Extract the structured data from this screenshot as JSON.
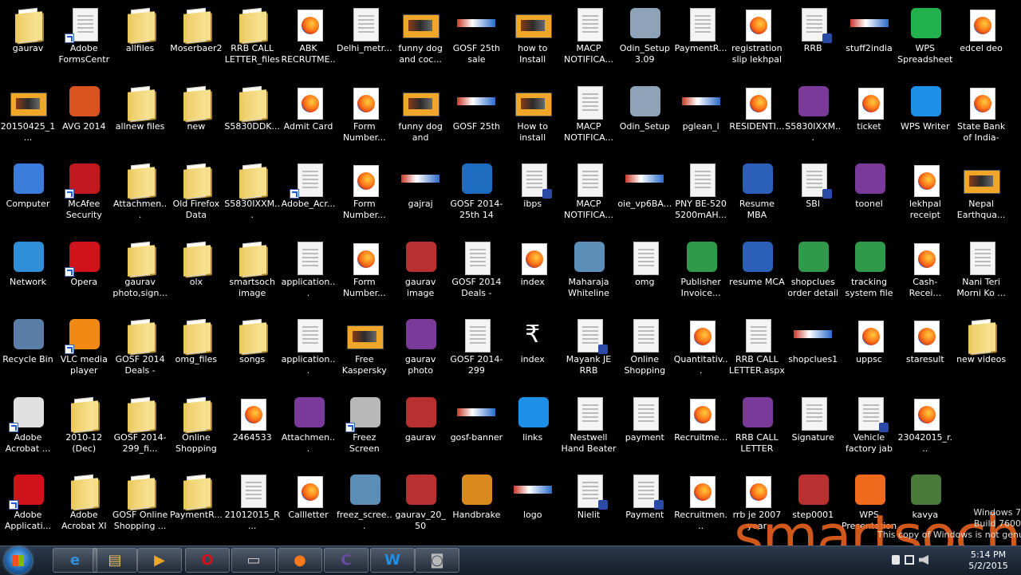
{
  "desktop": {
    "icons": [
      {
        "label": "gaurav",
        "type": "folder",
        "col": 0,
        "row": 0
      },
      {
        "label": "Adobe FormsCentral",
        "type": "doc",
        "col": 1,
        "row": 0,
        "shortcut": true
      },
      {
        "label": "allfiles",
        "type": "folder",
        "col": 2,
        "row": 0
      },
      {
        "label": "Moserbaer2",
        "type": "folder",
        "col": 3,
        "row": 0
      },
      {
        "label": "RRB CALL LETTER_files",
        "type": "folder",
        "col": 4,
        "row": 0
      },
      {
        "label": "ABK RECRUTME...",
        "type": "ff",
        "col": 5,
        "row": 0
      },
      {
        "label": "Delhi_metr...",
        "type": "doc",
        "col": 6,
        "row": 0
      },
      {
        "label": "funny dog and coc...",
        "type": "vid",
        "col": 7,
        "row": 0
      },
      {
        "label": "GOSF 25th sale",
        "type": "banner",
        "col": 8,
        "row": 0
      },
      {
        "label": "how to Install Adobe Rea...",
        "type": "vid",
        "col": 9,
        "row": 0
      },
      {
        "label": "MACP NOTIFICA...",
        "type": "doc",
        "col": 10,
        "row": 0
      },
      {
        "label": "Odin_Setup 3.09",
        "type": "app",
        "col": 11,
        "row": 0,
        "color": "#8fa3b8"
      },
      {
        "label": "PaymentR...",
        "type": "doc",
        "col": 12,
        "row": 0
      },
      {
        "label": "registration slip lekhpal",
        "type": "ff",
        "col": 13,
        "row": 0
      },
      {
        "label": "RRB",
        "type": "doc",
        "col": 14,
        "row": 0,
        "pdf": true
      },
      {
        "label": "stuff2india",
        "type": "banner",
        "col": 15,
        "row": 0
      },
      {
        "label": "WPS Spreadsheets",
        "type": "app",
        "col": 16,
        "row": 0,
        "color": "#22b14c"
      },
      {
        "label": "edcel deo",
        "type": "ff",
        "col": 17,
        "row": 0
      },
      {
        "label": "20150425_1...",
        "type": "vid",
        "col": 0,
        "row": 1
      },
      {
        "label": "AVG 2014",
        "type": "app",
        "col": 1,
        "row": 1,
        "color": "#d9531e"
      },
      {
        "label": "allnew files",
        "type": "folder",
        "col": 2,
        "row": 1
      },
      {
        "label": "new",
        "type": "folder",
        "col": 3,
        "row": 1
      },
      {
        "label": "S5830DDK...",
        "type": "folder",
        "col": 4,
        "row": 1
      },
      {
        "label": "Admit Card",
        "type": "ff",
        "col": 5,
        "row": 1
      },
      {
        "label": "Form Number...",
        "type": "ff",
        "col": 6,
        "row": 1
      },
      {
        "label": "funny dog and cockro...",
        "type": "vid",
        "col": 7,
        "row": 1
      },
      {
        "label": "GOSF 25th",
        "type": "banner",
        "col": 8,
        "row": 1
      },
      {
        "label": "How to install filezil...",
        "type": "vid",
        "col": 9,
        "row": 1
      },
      {
        "label": "MACP NOTIFICA...",
        "type": "doc",
        "col": 10,
        "row": 1
      },
      {
        "label": "Odin_Setup",
        "type": "app",
        "col": 11,
        "row": 1,
        "color": "#8fa3b8"
      },
      {
        "label": "pglean_l",
        "type": "banner",
        "col": 12,
        "row": 1
      },
      {
        "label": "RESIDENTI...",
        "type": "ff",
        "col": 13,
        "row": 1
      },
      {
        "label": "S5830IXXM...",
        "type": "app",
        "col": 14,
        "row": 1,
        "color": "#7a3a9a"
      },
      {
        "label": "ticket",
        "type": "ff",
        "col": 15,
        "row": 1
      },
      {
        "label": "WPS Writer",
        "type": "app",
        "col": 16,
        "row": 1,
        "color": "#1e90e8"
      },
      {
        "label": "State Bank of India-UPSS...",
        "type": "ff",
        "col": 17,
        "row": 1
      },
      {
        "label": "Computer",
        "type": "app",
        "col": 0,
        "row": 2,
        "color": "#3b7ddb"
      },
      {
        "label": "McAfee Security Sc...",
        "type": "app",
        "col": 1,
        "row": 2,
        "color": "#c0181e",
        "shortcut": true
      },
      {
        "label": "Attachmen...",
        "type": "folder",
        "col": 2,
        "row": 2
      },
      {
        "label": "Old Firefox Data",
        "type": "folder",
        "col": 3,
        "row": 2
      },
      {
        "label": "S5830IXXM...",
        "type": "folder",
        "col": 4,
        "row": 2
      },
      {
        "label": "Adobe_Acr...",
        "type": "doc",
        "col": 5,
        "row": 2,
        "shortcut": true
      },
      {
        "label": "Form Number...",
        "type": "ff",
        "col": 6,
        "row": 2
      },
      {
        "label": "gajraj",
        "type": "banner",
        "col": 7,
        "row": 2
      },
      {
        "label": "GOSF 2014-25th 14 mi...",
        "type": "app",
        "col": 8,
        "row": 2,
        "color": "#1e6cc0"
      },
      {
        "label": "ibps",
        "type": "doc",
        "col": 9,
        "row": 2,
        "pdf": true
      },
      {
        "label": "MACP NOTIFICA...",
        "type": "doc",
        "col": 10,
        "row": 2
      },
      {
        "label": "oie_vp6BA...",
        "type": "banner",
        "col": 11,
        "row": 2
      },
      {
        "label": "PNY BE-520 5200mAH...",
        "type": "doc",
        "col": 12,
        "row": 2
      },
      {
        "label": "Resume MBA",
        "type": "app",
        "col": 13,
        "row": 2,
        "color": "#2b5fb8"
      },
      {
        "label": "SBI",
        "type": "doc",
        "col": 14,
        "row": 2,
        "pdf": true
      },
      {
        "label": "toonel",
        "type": "app",
        "col": 15,
        "row": 2,
        "color": "#7a3a9a"
      },
      {
        "label": "lekhpal receipt",
        "type": "ff",
        "col": 16,
        "row": 2
      },
      {
        "label": "Nepal Earthqua...",
        "type": "vid",
        "col": 17,
        "row": 2
      },
      {
        "label": "Network",
        "type": "app",
        "col": 0,
        "row": 3,
        "color": "#2f8fd8"
      },
      {
        "label": "Opera",
        "type": "app",
        "col": 1,
        "row": 3,
        "color": "#d0121b",
        "shortcut": true
      },
      {
        "label": "gaurav photo,sign...",
        "type": "folder",
        "col": 2,
        "row": 3
      },
      {
        "label": "olx",
        "type": "folder",
        "col": 3,
        "row": 3
      },
      {
        "label": "smartsoch image",
        "type": "folder",
        "col": 4,
        "row": 3
      },
      {
        "label": "application...",
        "type": "doc",
        "col": 5,
        "row": 3
      },
      {
        "label": "Form Number...",
        "type": "ff",
        "col": 6,
        "row": 3
      },
      {
        "label": "gaurav image",
        "type": "app",
        "col": 7,
        "row": 3,
        "color": "#b83030"
      },
      {
        "label": "GOSF 2014 Deals - Gre...",
        "type": "doc",
        "col": 8,
        "row": 3
      },
      {
        "label": "index",
        "type": "ff",
        "col": 9,
        "row": 3
      },
      {
        "label": "Maharaja Whiteline S...",
        "type": "app",
        "col": 10,
        "row": 3,
        "color": "#5b8fb8"
      },
      {
        "label": "omg",
        "type": "doc",
        "col": 11,
        "row": 3
      },
      {
        "label": "Publisher Invoice...",
        "type": "app",
        "col": 12,
        "row": 3,
        "color": "#2f9a4a"
      },
      {
        "label": "resume MCA",
        "type": "app",
        "col": 13,
        "row": 3,
        "color": "#2b5fb8"
      },
      {
        "label": "shopclues order detail",
        "type": "app",
        "col": 14,
        "row": 3,
        "color": "#2f9a4a"
      },
      {
        "label": "tracking system file",
        "type": "app",
        "col": 15,
        "row": 3,
        "color": "#2f9a4a"
      },
      {
        "label": "Cash-Recei...",
        "type": "ff",
        "col": 16,
        "row": 3
      },
      {
        "label": "Nani Teri Morni Ko ...",
        "type": "doc",
        "col": 17,
        "row": 3
      },
      {
        "label": "Recycle Bin",
        "type": "app",
        "col": 0,
        "row": 4,
        "color": "#5a7ea8"
      },
      {
        "label": "VLC media player",
        "type": "app",
        "col": 1,
        "row": 4,
        "color": "#f08a14",
        "shortcut": true
      },
      {
        "label": "GOSF 2014 Deals - Gre...",
        "type": "folder",
        "col": 2,
        "row": 4
      },
      {
        "label": "omg_files",
        "type": "folder",
        "col": 3,
        "row": 4
      },
      {
        "label": "songs",
        "type": "folder",
        "col": 4,
        "row": 4
      },
      {
        "label": "application...",
        "type": "doc",
        "col": 5,
        "row": 4
      },
      {
        "label": "Free Kaspersky I...",
        "type": "vid",
        "col": 6,
        "row": 4
      },
      {
        "label": "gaurav photo signature",
        "type": "app",
        "col": 7,
        "row": 4,
        "color": "#7a3a9a"
      },
      {
        "label": "GOSF 2014-299",
        "type": "doc",
        "col": 8,
        "row": 4
      },
      {
        "label": "index",
        "type": "glyph",
        "glyph": "₹",
        "col": 9,
        "row": 4
      },
      {
        "label": "Mayank JE RRB",
        "type": "doc",
        "col": 10,
        "row": 4,
        "pdf": true
      },
      {
        "label": "Online Shopping F...",
        "type": "doc",
        "col": 11,
        "row": 4
      },
      {
        "label": "Quantitativ...",
        "type": "ff",
        "col": 12,
        "row": 4
      },
      {
        "label": "RRB CALL LETTER.aspx",
        "type": "doc",
        "col": 13,
        "row": 4
      },
      {
        "label": "shopclues1",
        "type": "banner",
        "col": 14,
        "row": 4
      },
      {
        "label": "uppsc",
        "type": "ff",
        "col": 15,
        "row": 4
      },
      {
        "label": "staresult",
        "type": "ff",
        "col": 16,
        "row": 4
      },
      {
        "label": "new videos",
        "type": "folder",
        "col": 17,
        "row": 4
      },
      {
        "label": "Adobe Acrobat ...",
        "type": "app",
        "col": 0,
        "row": 5,
        "color": "#e0e0e0",
        "shortcut": true
      },
      {
        "label": "2010-12 (Dec)",
        "type": "folder",
        "col": 1,
        "row": 5
      },
      {
        "label": "GOSF 2014-299_fi...",
        "type": "folder",
        "col": 2,
        "row": 5
      },
      {
        "label": "Online Shopping F...",
        "type": "folder",
        "col": 3,
        "row": 5
      },
      {
        "label": "2464533",
        "type": "ff",
        "col": 4,
        "row": 5
      },
      {
        "label": "Attachmen...",
        "type": "app",
        "col": 5,
        "row": 5,
        "color": "#7a3a9a"
      },
      {
        "label": "Freez Screen Video Cap...",
        "type": "app",
        "col": 6,
        "row": 5,
        "color": "#b8b8b8",
        "shortcut": true
      },
      {
        "label": "gaurav",
        "type": "app",
        "col": 7,
        "row": 5,
        "color": "#b83030"
      },
      {
        "label": "gosf-banner",
        "type": "banner",
        "col": 8,
        "row": 5
      },
      {
        "label": "links",
        "type": "app",
        "col": 9,
        "row": 5,
        "color": "#1e90e8"
      },
      {
        "label": "Nestwell Hand Beater",
        "type": "doc",
        "col": 10,
        "row": 5
      },
      {
        "label": "payment",
        "type": "doc",
        "col": 11,
        "row": 5
      },
      {
        "label": "Recruitme...",
        "type": "ff",
        "col": 12,
        "row": 5
      },
      {
        "label": "RRB CALL LETTER",
        "type": "app",
        "col": 13,
        "row": 5,
        "color": "#7a3a9a"
      },
      {
        "label": "Signature",
        "type": "doc",
        "col": 14,
        "row": 5
      },
      {
        "label": "Vehicle factory jab",
        "type": "doc",
        "col": 15,
        "row": 5,
        "pdf": true
      },
      {
        "label": "23042015_r...",
        "type": "ff",
        "col": 16,
        "row": 5
      },
      {
        "label": "Adobe Applicati...",
        "type": "app",
        "col": 0,
        "row": 6,
        "color": "#d0121b",
        "shortcut": true
      },
      {
        "label": "Adobe Acrobat XI",
        "type": "folder",
        "col": 1,
        "row": 6
      },
      {
        "label": "GOSF Online Shopping ...",
        "type": "folder",
        "col": 2,
        "row": 6
      },
      {
        "label": "PaymentR...",
        "type": "folder",
        "col": 3,
        "row": 6
      },
      {
        "label": "21012015_R...",
        "type": "doc",
        "col": 4,
        "row": 6
      },
      {
        "label": "Callletter",
        "type": "ff",
        "col": 5,
        "row": 6
      },
      {
        "label": "freez_scree...",
        "type": "app",
        "col": 6,
        "row": 6,
        "color": "#5b8fb8"
      },
      {
        "label": "gaurav_20_50",
        "type": "app",
        "col": 7,
        "row": 6,
        "color": "#b83030"
      },
      {
        "label": "Handbrake",
        "type": "app",
        "col": 8,
        "row": 6,
        "color": "#d88a1e"
      },
      {
        "label": "logo",
        "type": "banner",
        "col": 9,
        "row": 6
      },
      {
        "label": "Nielit",
        "type": "doc",
        "col": 10,
        "row": 6,
        "pdf": true
      },
      {
        "label": "Payment",
        "type": "doc",
        "col": 11,
        "row": 6,
        "pdf": true
      },
      {
        "label": "Recruitmen...",
        "type": "ff",
        "col": 12,
        "row": 6
      },
      {
        "label": "rrb je 2007 year questi...",
        "type": "ff",
        "col": 13,
        "row": 6
      },
      {
        "label": "step0001",
        "type": "app",
        "col": 14,
        "row": 6,
        "color": "#b83030"
      },
      {
        "label": "WPS Presentation",
        "type": "app",
        "col": 15,
        "row": 6,
        "color": "#f06a1e"
      },
      {
        "label": "kavya",
        "type": "app",
        "col": 16,
        "row": 6,
        "color": "#4a7a3a"
      }
    ]
  },
  "watermark": {
    "line1": "Windows 7",
    "line2": "Build 7600",
    "line3": "This copy of Windows is not genuine"
  },
  "brand": "smartsoch",
  "tray": {
    "time": "5:14 PM",
    "date": "5/2/2015"
  },
  "taskbar": {
    "buttons": [
      {
        "name": "ie-button",
        "color": "#2f8fd8",
        "glyph": "e"
      },
      {
        "name": "explorer-button",
        "color": "#e8c45a",
        "glyph": "▤"
      },
      {
        "name": "media-player-button",
        "color": "#f0a628",
        "glyph": "▶"
      },
      {
        "name": "opera-button",
        "color": "#d0121b",
        "glyph": "O"
      },
      {
        "name": "blank-window-button",
        "color": "#cccccc",
        "glyph": "▭"
      },
      {
        "name": "firefox-button",
        "color": "#ff7a1a",
        "glyph": "●"
      },
      {
        "name": "app-c-button",
        "color": "#6a4aa8",
        "glyph": "C"
      },
      {
        "name": "wps-writer-button",
        "color": "#1e90e8",
        "glyph": "W"
      },
      {
        "name": "camera-button",
        "color": "#b8b8b8",
        "glyph": "◙"
      }
    ]
  }
}
